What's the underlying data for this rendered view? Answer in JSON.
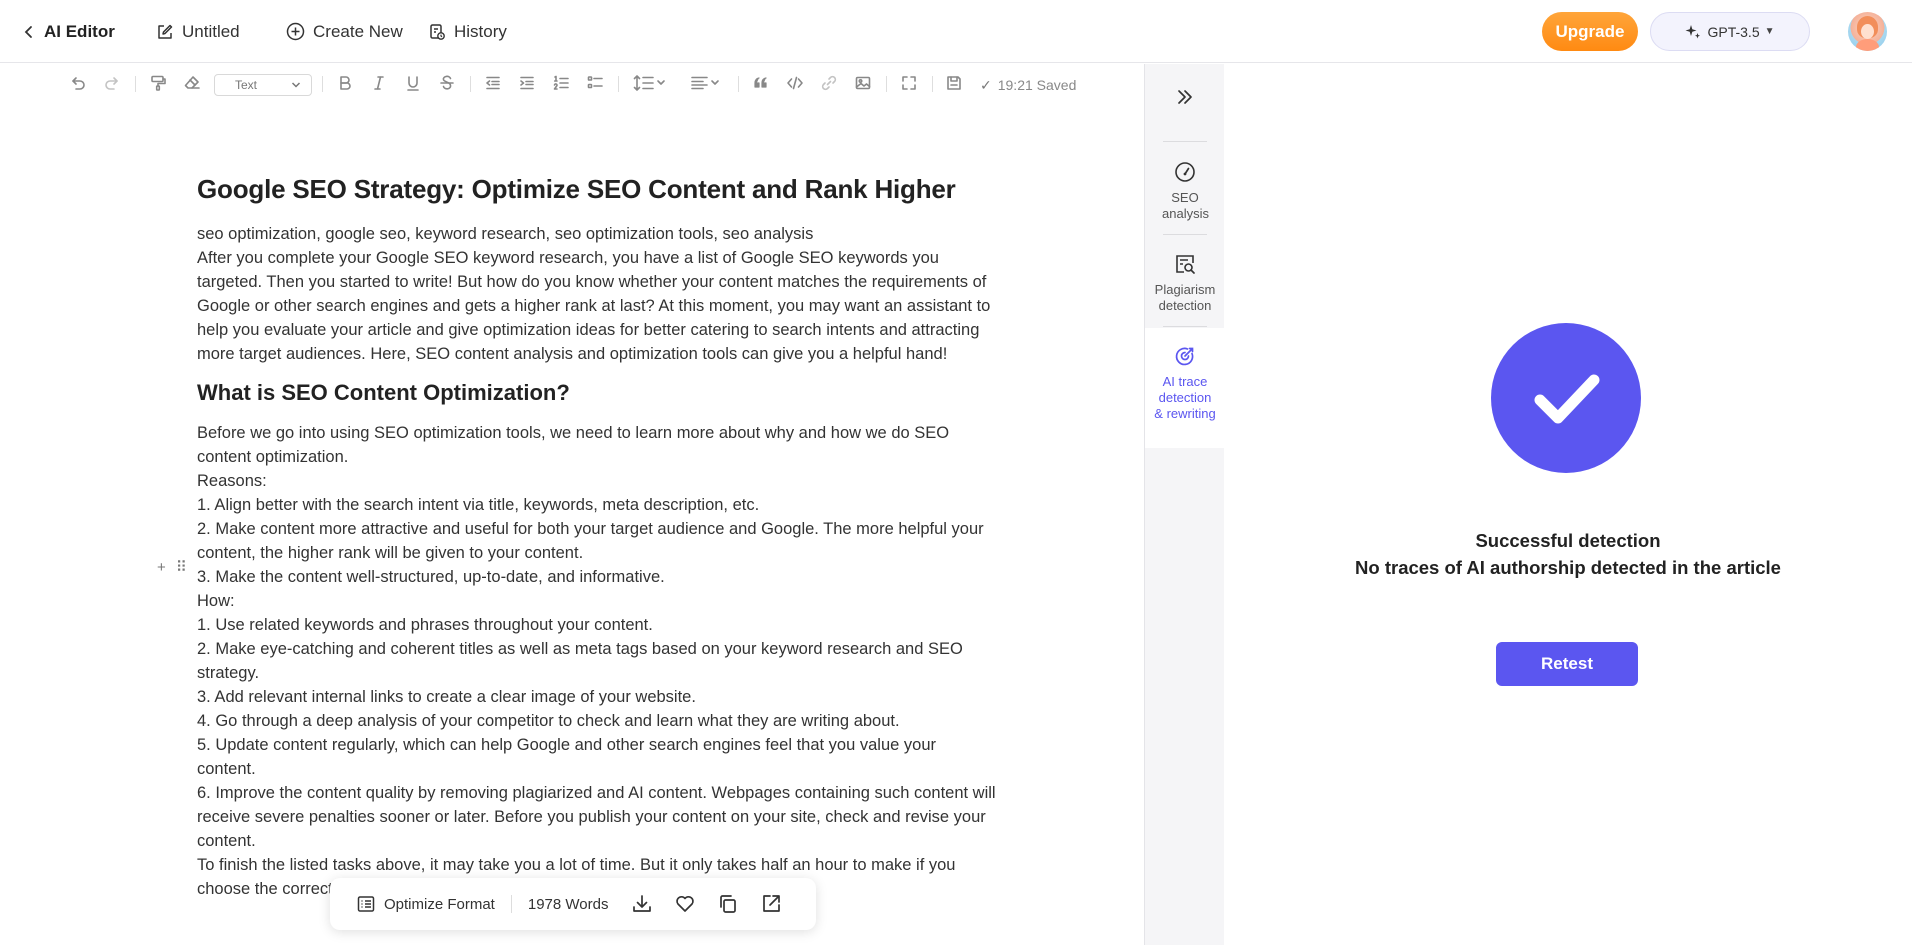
{
  "topbar": {
    "back_label": "AI Editor",
    "doc_title": "Untitled",
    "create_label": "Create New",
    "history_label": "History",
    "upgrade_label": "Upgrade",
    "model_label": "GPT-3.5"
  },
  "toolbar": {
    "text_style": "Text",
    "saved_time": "19:21 Saved"
  },
  "article": {
    "title": "Google SEO Strategy: Optimize SEO Content and Rank Higher",
    "keywords": "seo optimization, google seo, keyword research, seo optimization tools, seo analysis",
    "intro": "After you complete your Google SEO keyword research, you have a list of Google SEO keywords you targeted. Then you started to write! But how do you know whether your content matches the requirements of Google or other search engines and gets a higher rank at last? At this moment, you may want an assistant to help you evaluate your article and give optimization ideas for better catering to search intents and attracting more target audiences. Here, SEO content analysis and optimization tools can give you a helpful hand!",
    "heading2": "What is SEO Content Optimization?",
    "lines": [
      "Before we go into using SEO optimization tools, we need to learn more about why and how we do SEO content optimization.",
      "Reasons:",
      "1. Align better with the search intent via title, keywords, meta description, etc.",
      "2. Make content more attractive and useful for both your target audience and Google. The more helpful your content, the higher rank will be given to your content.",
      "3. Make the content well-structured, up-to-date, and informative.",
      "How:",
      "1. Use related keywords and phrases throughout your content.",
      "2. Make eye-catching and coherent titles as well as meta tags based on your keyword research and SEO strategy.",
      "3. Add relevant internal links to create a clear image of your website.",
      "4. Go through a deep analysis of your competitor to check and learn what they are writing about.",
      "5. Update content regularly, which can help Google and other search engines feel that you value your content.",
      "6. Improve the content quality by removing plagiarized and AI content. Webpages containing such content will receive severe penalties sooner or later. Before you publish your content on your site, check and revise your content.",
      "To finish the listed tasks above, it may take you a lot of time. But it only takes half an hour to make if you choose the correct SEO optimization tool to help you."
    ]
  },
  "floatbar": {
    "optimize_label": "Optimize Format",
    "word_count": "1978 Words"
  },
  "rail": {
    "items": [
      {
        "label": "SEO analysis"
      },
      {
        "label": "Plagiarism detection"
      },
      {
        "label": "AI trace detection & rewriting"
      }
    ]
  },
  "panel": {
    "status_title": "Successful detection",
    "status_message": "No traces of AI authorship detected in the article",
    "retest_label": "Retest"
  },
  "colors": {
    "accent": "#5b56f0",
    "upgrade": "#ff8a12"
  },
  "icons": [
    "chevron-left-icon",
    "edit-icon",
    "plus-circle-icon",
    "history-icon",
    "sparkle-icon",
    "chevrons-right-icon",
    "speedometer-icon",
    "search-doc-icon",
    "target-icon",
    "checkmark-icon"
  ]
}
